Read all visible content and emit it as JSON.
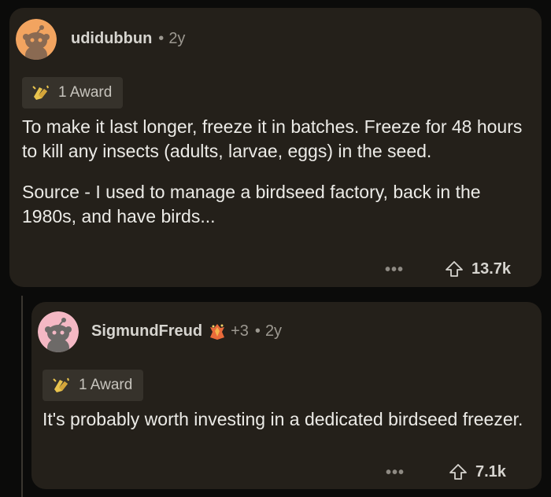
{
  "comments": [
    {
      "username": "udidubbun",
      "separator": "•",
      "age": "2y",
      "award_label": "1 Award",
      "paragraphs": [
        "To make it last longer, freeze it in batches. Freeze for 48 hours to kill any insects (adults, larvae, eggs) in the seed.",
        "Source - I used to manage a birdseed factory, back in the 1980s, and have birds..."
      ],
      "more": "•••",
      "upvotes": "13.7k",
      "avatar_color": "#f2a460"
    },
    {
      "username": "SigmundFreud",
      "karma_bonus": "+3",
      "separator": "•",
      "age": "2y",
      "award_label": "1 Award",
      "paragraphs": [
        "It's probably worth investing in a dedicated birdseed freezer."
      ],
      "more": "•••",
      "upvotes": "7.1k",
      "avatar_color": "#f4b8c4"
    }
  ],
  "icons": {
    "award": "clapping-hands-award-icon",
    "flair": "crystal-flair-icon",
    "upvote": "upvote-arrow-icon"
  }
}
